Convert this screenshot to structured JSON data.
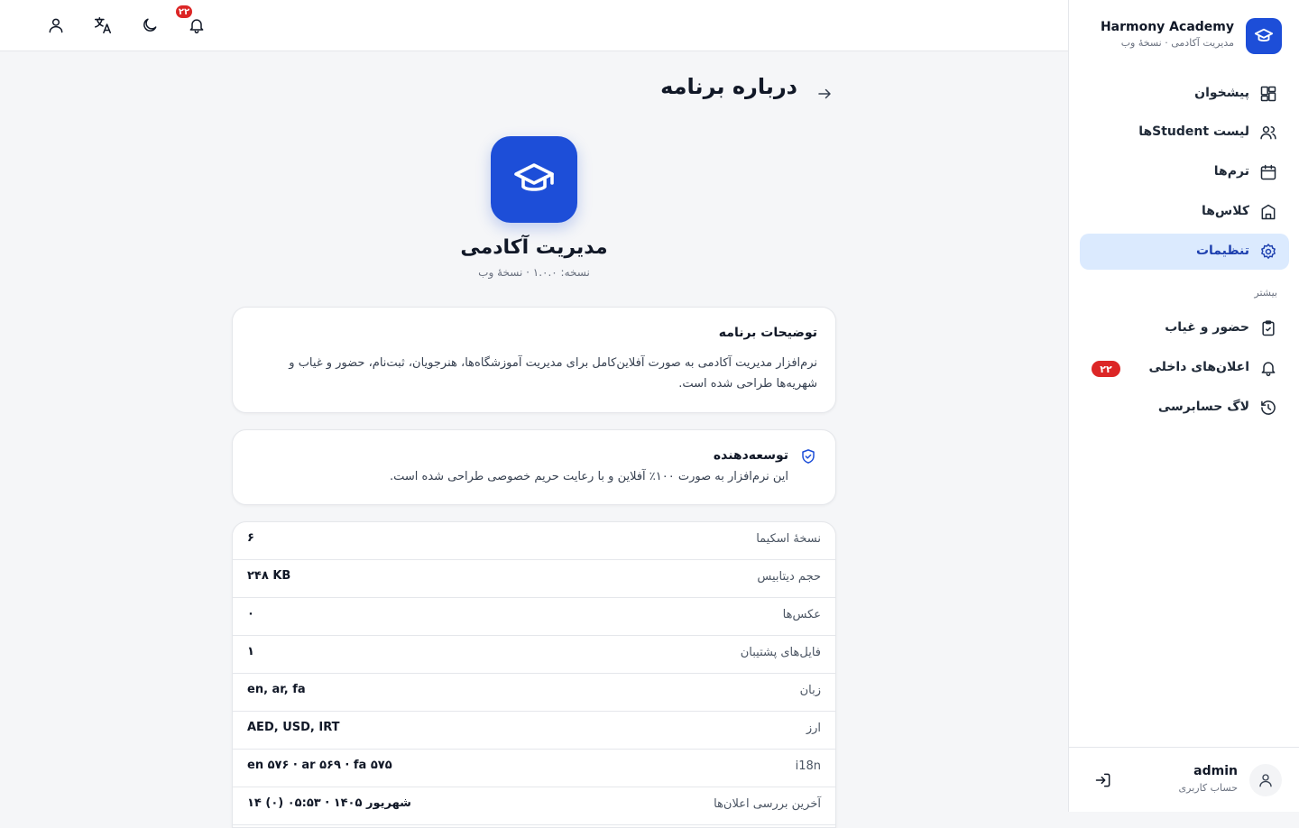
{
  "topbar": {
    "notifications_badge": "۲۲",
    "icons": [
      "user-icon",
      "translate-icon",
      "moon-icon",
      "bell-icon"
    ]
  },
  "sidebar": {
    "brand_name": "Harmony Academy",
    "brand_sub": "مدیریت آکادمی · نسخهٔ وب",
    "items": [
      {
        "label": "پیشخوان",
        "icon": "dashboard-icon"
      },
      {
        "label": "لیست Studentها",
        "icon": "users-icon"
      },
      {
        "label": "ترم‌ها",
        "icon": "calendar-icon"
      },
      {
        "label": "کلاس‌ها",
        "icon": "building-icon"
      },
      {
        "label": "تنظیمات",
        "icon": "gear-icon",
        "active": true
      }
    ],
    "more_title": "بیشتر",
    "more_items": [
      {
        "label": "حضور و غیاب",
        "icon": "clipboard-icon"
      },
      {
        "label": "اعلان‌های داخلی",
        "icon": "bell-icon",
        "badge": "۲۲"
      },
      {
        "label": "لاگ حسابرسی",
        "icon": "history-icon"
      }
    ],
    "user": {
      "name": "admin",
      "role": "حساب کاربری"
    }
  },
  "main": {
    "page_title": "درباره برنامه",
    "app_name": "مدیریت آکادمی",
    "app_version": "نسخه: ۱.۰.۰ · نسخهٔ وب",
    "description": {
      "title": "توضیحات برنامه",
      "body": "نرم‌افزار مدیریت آکادمی به صورت آفلاین‌کامل برای مدیریت آموزشگاه‌ها، هنرجویان، ثبت‌نام، حضور و غیاب و شهریه‌ها طراحی شده است."
    },
    "developer": {
      "title": "توسعه‌دهنده",
      "body": "این نرم‌افزار به صورت ۱۰۰٪ آفلاین و با رعایت حریم خصوصی طراحی شده است."
    },
    "info_rows": [
      {
        "label": "نسخهٔ اسکیما",
        "value": "۶"
      },
      {
        "label": "حجم دیتابیس",
        "value": "۲۴۸ KB"
      },
      {
        "label": "عکس‌ها",
        "value": "۰"
      },
      {
        "label": "فایل‌های پشتیبان",
        "value": "۱"
      },
      {
        "label": "زبان",
        "value": "en, ar, fa"
      },
      {
        "label": "ارز",
        "value": "AED, USD, IRT"
      },
      {
        "label": "i18n",
        "value": "en ۵۷۶ · ar ۵۶۹ · fa ۵۷۵"
      },
      {
        "label": "آخرین بررسی اعلان‌ها",
        "value": "شهریور ۱۴۰۵ · ۰۵:۵۳ (۰) ۱۴"
      }
    ]
  },
  "colors": {
    "accent": "#1d4ed8",
    "active_bg": "#dbeafe",
    "badge": "#dc2626"
  }
}
